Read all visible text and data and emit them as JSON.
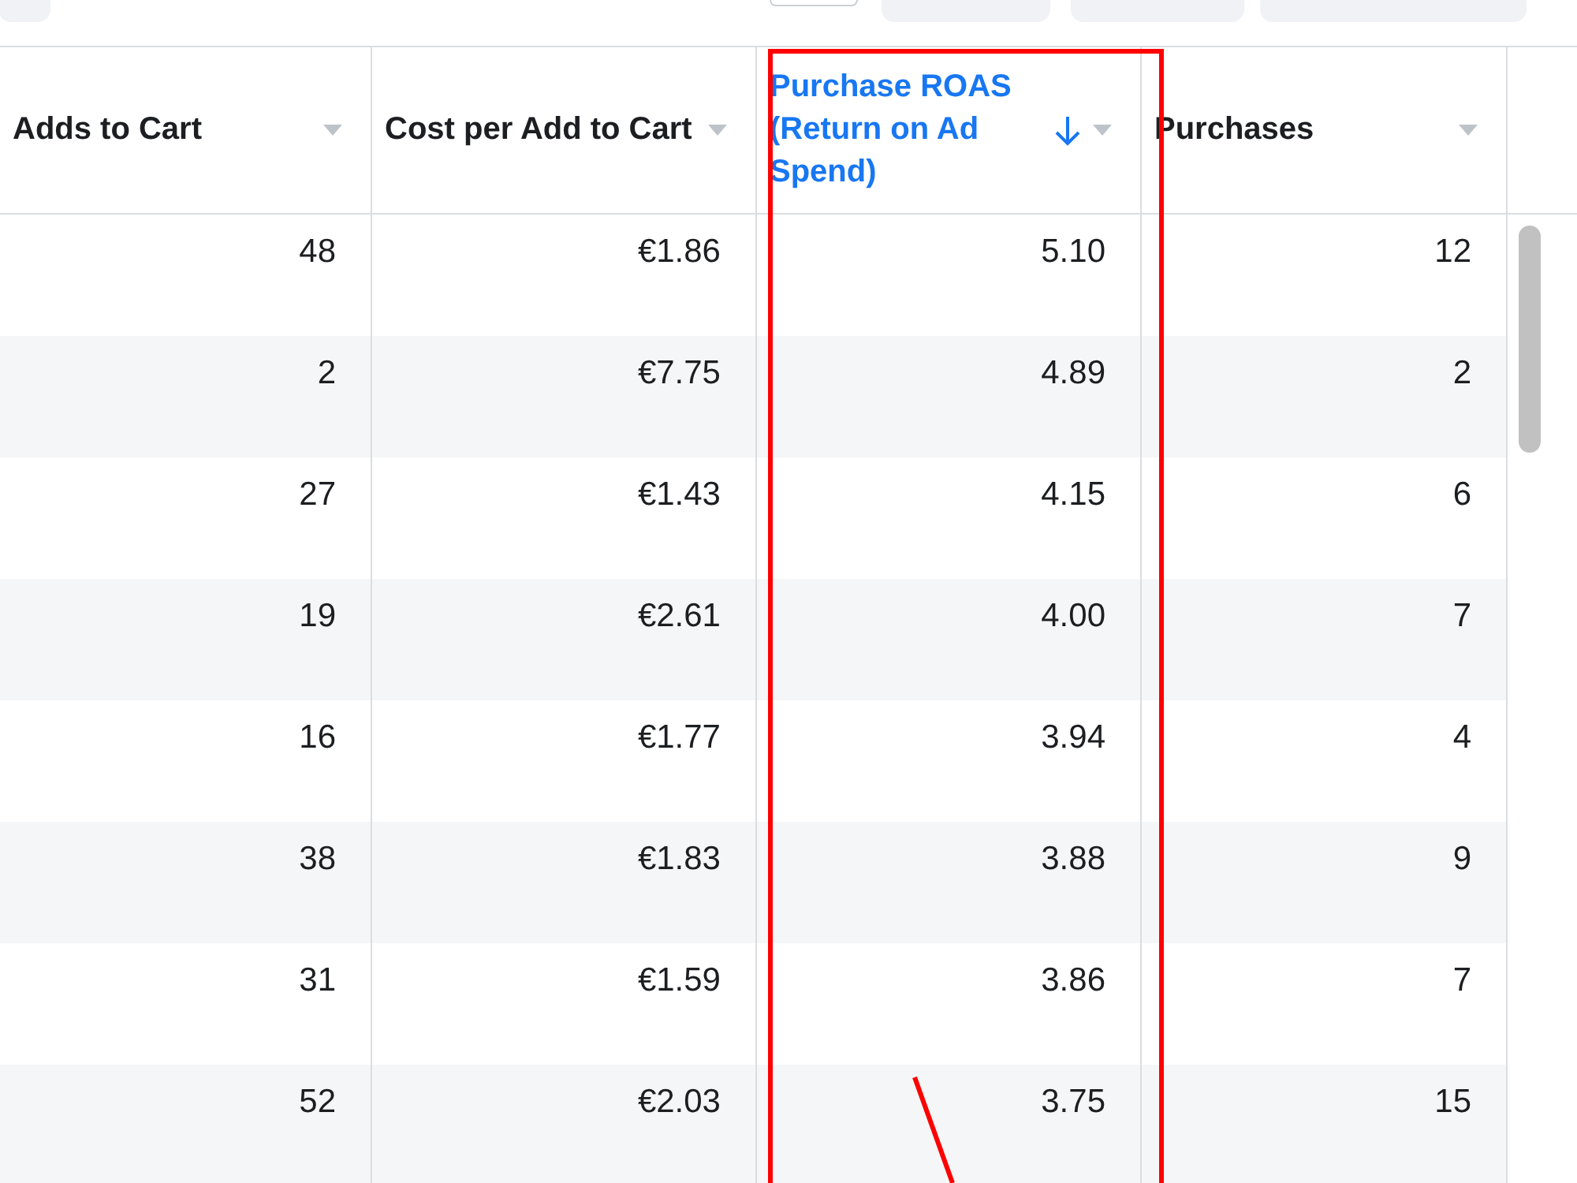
{
  "table": {
    "columns": [
      {
        "label": "Adds to Cart",
        "sorted": false
      },
      {
        "label": "Cost per Add to Cart",
        "sorted": false
      },
      {
        "label": "Purchase ROAS (Return on Ad Spend)",
        "sorted": true
      },
      {
        "label": "Purchases",
        "sorted": false
      }
    ],
    "rows": [
      [
        "48",
        "€1.86",
        "5.10",
        "12"
      ],
      [
        "2",
        "€7.75",
        "4.89",
        "2"
      ],
      [
        "27",
        "€1.43",
        "4.15",
        "6"
      ],
      [
        "19",
        "€2.61",
        "4.00",
        "7"
      ],
      [
        "16",
        "€1.77",
        "3.94",
        "4"
      ],
      [
        "38",
        "€1.83",
        "3.88",
        "9"
      ],
      [
        "31",
        "€1.59",
        "3.86",
        "7"
      ],
      [
        "52",
        "€2.03",
        "3.75",
        "15"
      ]
    ]
  }
}
